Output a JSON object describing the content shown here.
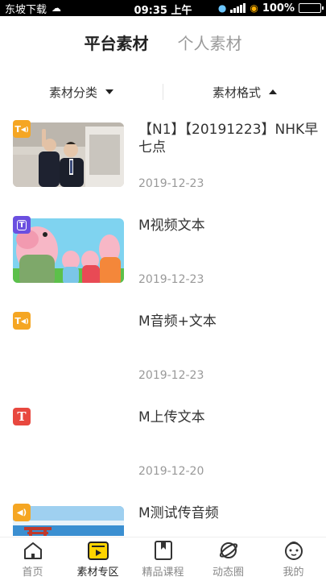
{
  "status_bar": {
    "carrier": "东坡下载",
    "time": "09:35 上午",
    "battery": "100%"
  },
  "tabs": [
    {
      "label": "平台素材",
      "active": true
    },
    {
      "label": "个人素材",
      "active": false
    }
  ],
  "filters": {
    "category_label": "素材分类",
    "format_label": "素材格式"
  },
  "items": [
    {
      "title": "【N1】【20191223】NHK早七点",
      "date": "2019-12-23",
      "badge": "T",
      "badge_type": "text-audio",
      "thumb": "news-photo"
    },
    {
      "title": "M视频文本",
      "date": "2019-12-23",
      "badge": "T",
      "badge_type": "text-video",
      "thumb": "cartoon-pigs"
    },
    {
      "title": "M音频+文本",
      "date": "2019-12-23",
      "badge": "T",
      "badge_type": "text-audio",
      "thumb": null
    },
    {
      "title": "M上传文本",
      "date": "2019-12-20",
      "badge": "T",
      "badge_type": "text",
      "thumb": null
    },
    {
      "title": "M测试传音频",
      "date": "",
      "badge": "",
      "badge_type": "audio",
      "thumb": "sea-torii"
    }
  ],
  "bottom_nav": [
    {
      "label": "首页",
      "icon": "home-icon",
      "active": false
    },
    {
      "label": "素材专区",
      "icon": "materials-icon",
      "active": true
    },
    {
      "label": "精品课程",
      "icon": "bookmark-icon",
      "active": false
    },
    {
      "label": "动态圈",
      "icon": "planet-icon",
      "active": false
    },
    {
      "label": "我的",
      "icon": "profile-icon",
      "active": false
    }
  ],
  "colors": {
    "accent_yellow": "#ffd400",
    "badge_orange": "#f5a623",
    "badge_purple": "#6b4fe0",
    "badge_red": "#e8483f"
  }
}
